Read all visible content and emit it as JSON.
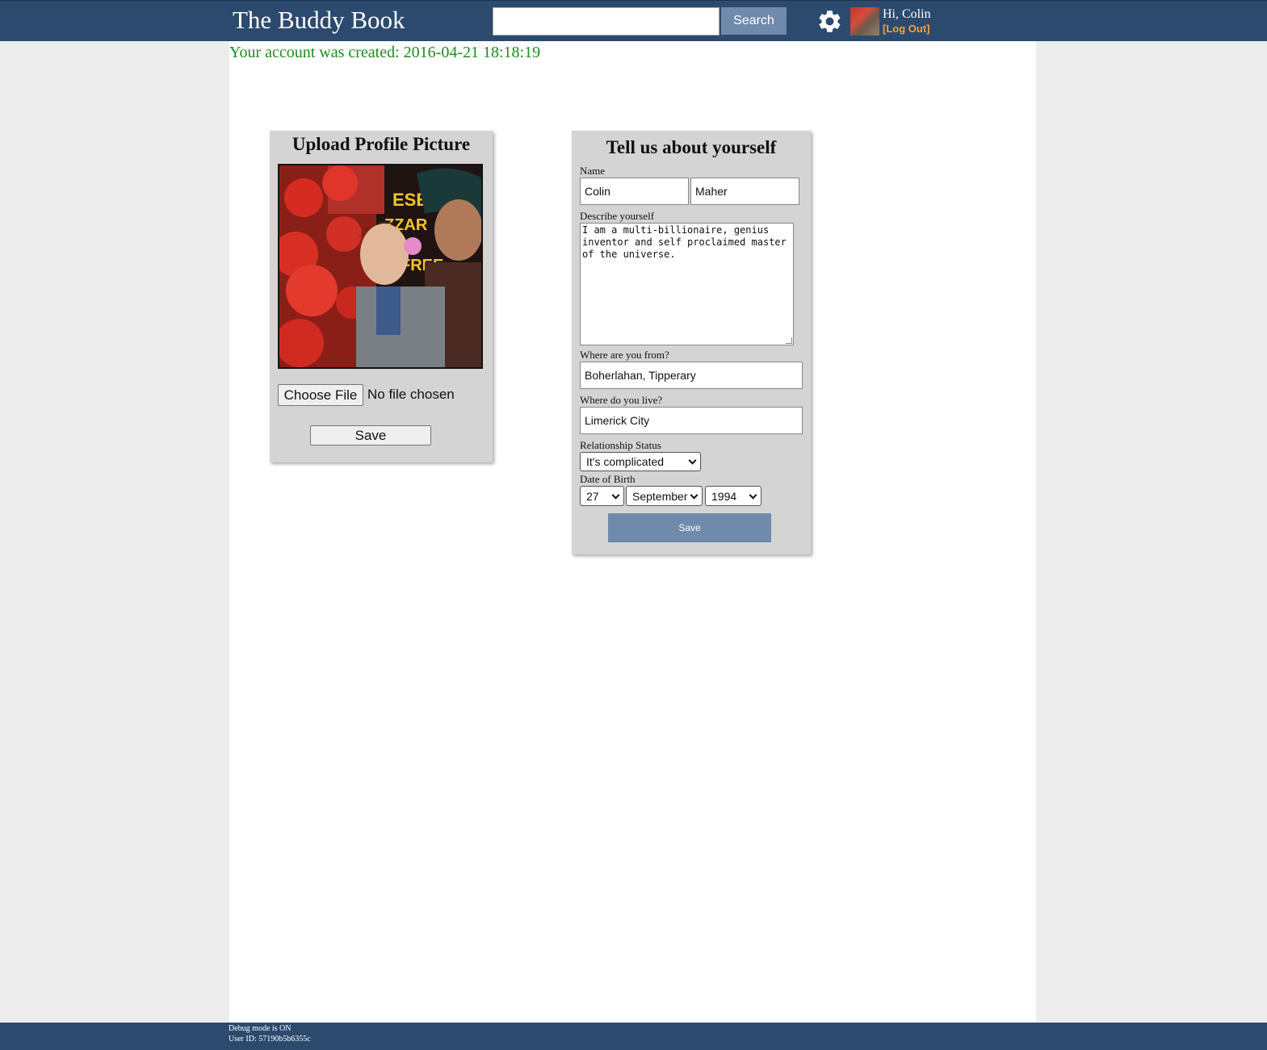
{
  "header": {
    "logo": "The Buddy Book",
    "search_value": "",
    "search_button": "Search",
    "settings_icon": "gear-icon",
    "greeting": "Hi, Colin",
    "logout": "[Log Out]"
  },
  "notice": "Your account was created: 2016-04-21 18:18:19",
  "upload": {
    "title": "Upload Profile Picture",
    "choose_file": "Choose File",
    "no_file": "No file chosen",
    "save": "Save"
  },
  "about": {
    "title": "Tell us about yourself",
    "name_label": "Name",
    "first_name": "Colin",
    "last_name": "Maher",
    "describe_label": "Describe yourself",
    "describe_value": "I am a multi-billionaire, genius inventor and self proclaimed master of the universe.",
    "from_label": "Where are you from?",
    "from_value": "Boherlahan, Tipperary",
    "live_label": "Where do you live?",
    "live_value": "Limerick City",
    "relationship_label": "Relationship Status",
    "relationship_value": "It's complicated",
    "dob_label": "Date of Birth",
    "dob_day": "27",
    "dob_month": "September",
    "dob_year": "1994",
    "save": "Save"
  },
  "footer": {
    "debug": "Debug mode is ON",
    "user_id": "User ID: 57190b5b6355c"
  },
  "colors": {
    "header_bg": "#2c4a6e",
    "button_bg": "#6f8aab",
    "notice_green": "#1e8a1e",
    "logout_orange": "#f3a23a",
    "panel_bg": "#d4d4d4"
  }
}
